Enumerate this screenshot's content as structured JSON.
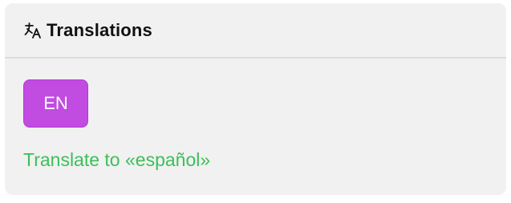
{
  "panel": {
    "title": "Translations",
    "icon": "translate-icon"
  },
  "badge": {
    "label": "EN",
    "color": "#c24be1"
  },
  "action": {
    "label": "Translate to «español»",
    "color": "#3cbf59"
  }
}
